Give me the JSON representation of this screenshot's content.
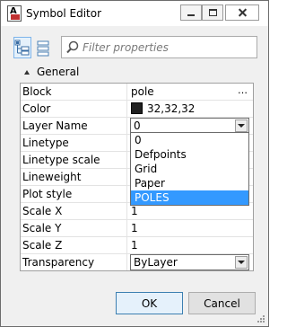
{
  "window": {
    "title": "Symbol Editor"
  },
  "toolbar": {
    "search_placeholder": "Filter properties"
  },
  "group": {
    "label": "General"
  },
  "properties": [
    {
      "name": "Block",
      "value": "pole",
      "kind": "ellipsis"
    },
    {
      "name": "Color",
      "value": "32,32,32",
      "kind": "color",
      "color": "#202020"
    },
    {
      "name": "Layer Name",
      "value": "0",
      "kind": "combo"
    },
    {
      "name": "Linetype",
      "value": "",
      "kind": "text"
    },
    {
      "name": "Linetype scale",
      "value": "",
      "kind": "text"
    },
    {
      "name": "Lineweight",
      "value": "",
      "kind": "text"
    },
    {
      "name": "Plot style",
      "value": "",
      "kind": "text"
    },
    {
      "name": "Scale X",
      "value": "1",
      "kind": "text"
    },
    {
      "name": "Scale Y",
      "value": "1",
      "kind": "text"
    },
    {
      "name": "Scale Z",
      "value": "1",
      "kind": "text"
    },
    {
      "name": "Transparency",
      "value": "ByLayer",
      "kind": "combo"
    }
  ],
  "layer_dropdown": {
    "options": [
      "0",
      "Defpoints",
      "Grid",
      "Paper",
      "POLES"
    ],
    "highlighted": "POLES"
  },
  "buttons": {
    "ok": "OK",
    "cancel": "Cancel"
  },
  "colors": {
    "selection": "#3399ff",
    "accent_border": "#3c7fb1"
  }
}
